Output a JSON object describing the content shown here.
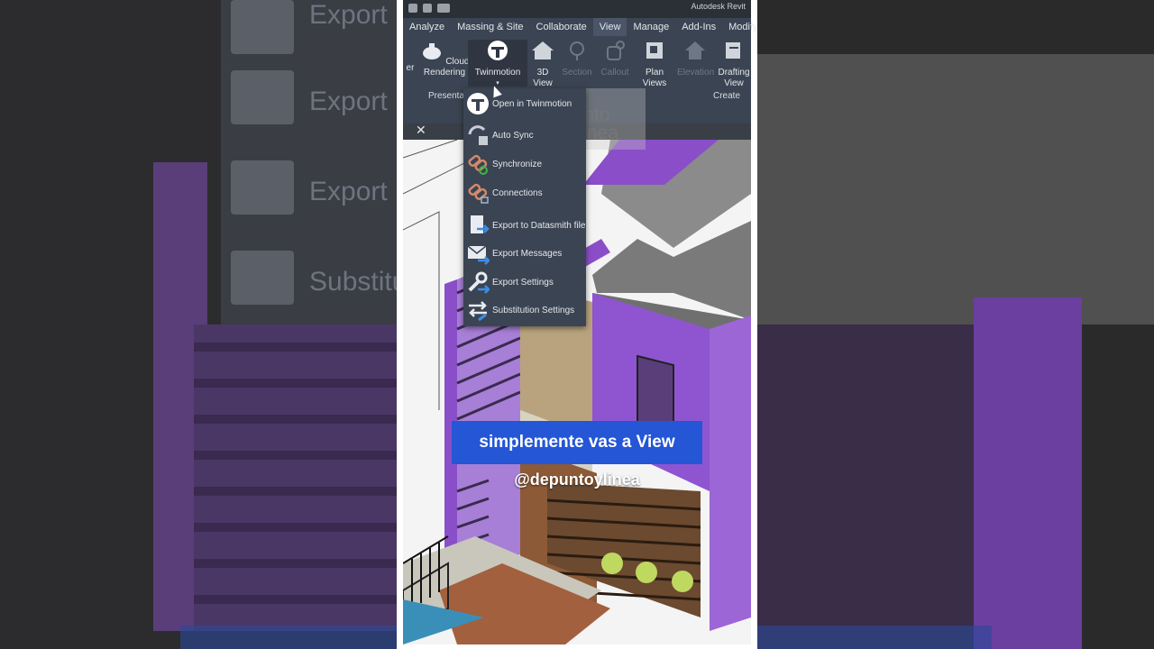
{
  "titlebar": {
    "app_title": "Autodesk Revit"
  },
  "tabs": [
    "Analyze",
    "Massing & Site",
    "Collaborate",
    "View",
    "Manage",
    "Add-Ins",
    "Modify"
  ],
  "active_tab": "View",
  "ribbon": {
    "partial_left": "er",
    "cloud_rendering": "Cloud\nRendering",
    "twinmotion": "Twinmotion",
    "view_3d": "3D\nView",
    "section": "Section",
    "callout": "Callout",
    "plan_views": "Plan\nViews",
    "elevation": "Elevation",
    "drafting_view": "Drafting\nView",
    "panel_presentation": "Presentat",
    "panel_create": "Create"
  },
  "twinmotion_menu": {
    "items": [
      {
        "label": "Open in Twinmotion",
        "icon": "twinmotion-icon"
      },
      {
        "label": "Auto Sync",
        "icon": "auto-sync-icon"
      },
      {
        "label": "Synchronize",
        "icon": "synchronize-icon"
      },
      {
        "label": "Connections",
        "icon": "connections-icon"
      },
      {
        "label": "Export to Datasmith file",
        "icon": "export-datasmith-icon"
      },
      {
        "label": "Export Messages",
        "icon": "export-messages-icon"
      },
      {
        "label": "Export Settings",
        "icon": "export-settings-icon"
      },
      {
        "label": "Substitution Settings",
        "icon": "substitution-settings-icon"
      }
    ]
  },
  "watermark": "de\npunto\ny línea",
  "caption": "simplemente vas a View",
  "handle": "@depuntoylinea",
  "side_labels": [
    "Export",
    "Export",
    "Export",
    "Substitu"
  ],
  "colors": {
    "caption_bg": "#2456d6",
    "ribbon_bg": "#3b4452",
    "house_purple": "#8a4fc8"
  }
}
